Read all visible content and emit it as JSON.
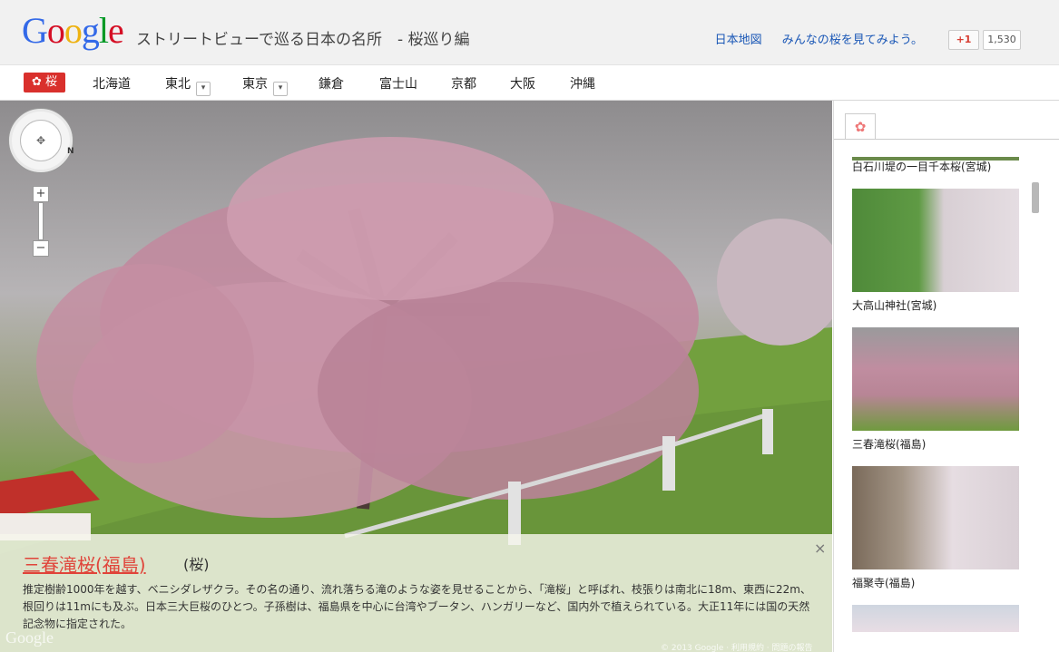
{
  "header": {
    "logo_letters": [
      "G",
      "o",
      "o",
      "g",
      "l",
      "e"
    ],
    "logo_colors": [
      "#3369e8",
      "#d50f25",
      "#eeb211",
      "#3369e8",
      "#009925",
      "#d50f25"
    ],
    "title": "ストリートビューで巡る日本の名所　- 桜巡り編",
    "links": [
      "日本地図",
      "みんなの桜を見てみよう。"
    ],
    "gplus_label": "+1",
    "gplus_count": "1,530"
  },
  "nav": {
    "sakura_label": "桜",
    "items": [
      "北海道",
      "東北",
      "東京",
      "鎌倉",
      "富士山",
      "京都",
      "大阪",
      "沖縄"
    ]
  },
  "view": {
    "compass_label": "N",
    "zoom_in": "+",
    "zoom_out": "−",
    "watermark": "Google",
    "copyright": "© 2013 Google · 利用規約 · 問題の報告"
  },
  "info": {
    "name": "三春滝桜(福島)",
    "category": "(桜)",
    "close": "×",
    "description": "推定樹齢1000年を越す、ベニシダレザクラ。その名の通り、流れ落ちる滝のような姿を見せることから、「滝桜」と呼ばれ、枝張りは南北に18m、東西に22m、根回りは11mにも及ぶ。日本三大巨桜のひとつ。子孫樹は、福島県を中心に台湾やブータン、ハンガリーなど、国内外で植えられている。大正11年には国の天然記念物に指定された。"
  },
  "sidebar": {
    "tab_icon": "✿",
    "items": [
      {
        "label": "白石川堤の一目千本桜(宮城)"
      },
      {
        "label": "大高山神社(宮城)"
      },
      {
        "label": "三春滝桜(福島)"
      },
      {
        "label": "福聚寺(福島)"
      }
    ]
  },
  "colors": {
    "accent": "#d9302c",
    "link": "#1a57b6",
    "blossom": "#c98aa0"
  }
}
